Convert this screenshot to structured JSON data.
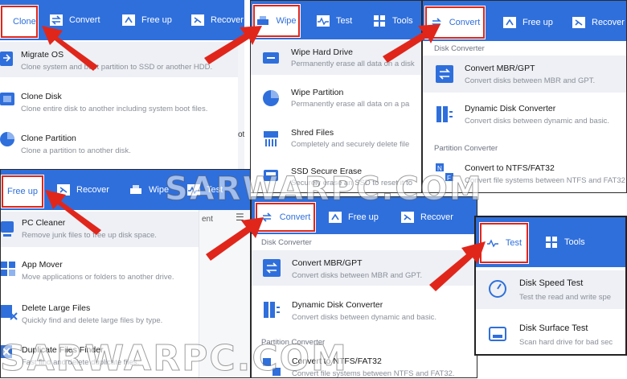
{
  "colors": {
    "brand": "#2f6fdc",
    "highlight": "#e0261b",
    "hover_bg": "#eef0f5",
    "icon_blue": "#2f6fdc"
  },
  "p1": {
    "tabs": [
      {
        "label": "Clone",
        "icon": "clone-icon",
        "active": true
      },
      {
        "label": "Convert",
        "icon": "convert-icon"
      },
      {
        "label": "Free up",
        "icon": "free-up-icon"
      },
      {
        "label": "Recover",
        "icon": "recover-icon"
      }
    ],
    "items": [
      {
        "title": "Migrate OS",
        "desc": "Clone system and boot partition to SSD or another HDD.",
        "icon": "migrate-os-icon"
      },
      {
        "title": "Clone Disk",
        "desc": "Clone entire disk to another including system boot files.",
        "icon": "clone-disk-icon"
      },
      {
        "title": "Clone Partition",
        "desc": "Clone a partition to another disk.",
        "icon": "clone-partition-icon"
      }
    ],
    "fragments": [
      "ot",
      "ent"
    ]
  },
  "p2": {
    "tabs": [
      {
        "label": "Wipe",
        "icon": "wipe-icon",
        "active": true
      },
      {
        "label": "Test",
        "icon": "test-icon"
      },
      {
        "label": "Tools",
        "icon": "tools-icon"
      }
    ],
    "items": [
      {
        "title": "Wipe Hard Drive",
        "desc": "Permanently erase all data on a disk",
        "icon": "wipe-drive-icon"
      },
      {
        "title": "Wipe Partition",
        "desc": "Permanently erase all data on a pa",
        "icon": "wipe-partition-icon"
      },
      {
        "title": "Shred Files",
        "desc": "Completely and securely delete file",
        "icon": "shred-files-icon"
      },
      {
        "title": "SSD Secure Erase",
        "desc": "Securely erase an SSD to reset it to",
        "icon": "ssd-erase-icon"
      }
    ]
  },
  "p3": {
    "tabs": [
      {
        "label": "Convert",
        "icon": "convert-icon",
        "active": true
      },
      {
        "label": "Free up",
        "icon": "free-up-icon"
      },
      {
        "label": "Recover",
        "icon": "recover-icon"
      }
    ],
    "section1": "Disk Converter",
    "items": [
      {
        "title": "Convert MBR/GPT",
        "desc": "Convert disks between MBR and GPT.",
        "icon": "convert-mbr-gpt-icon"
      },
      {
        "title": "Dynamic Disk Converter",
        "desc": "Convert disks between dynamic and basic.",
        "icon": "dynamic-disk-icon"
      }
    ],
    "section2": "Partition Converter",
    "items2": [
      {
        "title": "Convert to NTFS/FAT32",
        "desc": "Convert file systems between NTFS and FAT32",
        "icon": "convert-ntfs-icon"
      }
    ]
  },
  "p4": {
    "tabs": [
      {
        "label": "Free up",
        "icon": "free-up-icon",
        "active": true
      },
      {
        "label": "Recover",
        "icon": "recover-icon"
      },
      {
        "label": "Wipe",
        "icon": "wipe-icon"
      },
      {
        "label": "Test",
        "icon": "test-icon"
      }
    ],
    "items": [
      {
        "title": "PC Cleaner",
        "desc": "Remove junk files to free up disk space.",
        "icon": "pc-cleaner-icon"
      },
      {
        "title": "App Mover",
        "desc": "Move applications or folders to another drive.",
        "icon": "app-mover-icon"
      },
      {
        "title": "Delete Large Files",
        "desc": "Quickly find and delete large files by type.",
        "icon": "delete-large-icon"
      },
      {
        "title": "Duplicate Files Finder",
        "desc": "Fast find and delete duplicate files.",
        "icon": "duplicate-finder-icon"
      }
    ]
  },
  "p5": {
    "tabs": [
      {
        "label": "Convert",
        "icon": "convert-icon",
        "active": true
      },
      {
        "label": "Free up",
        "icon": "free-up-icon"
      },
      {
        "label": "Recover",
        "icon": "recover-icon"
      }
    ],
    "section1": "Disk Converter",
    "items": [
      {
        "title": "Convert MBR/GPT",
        "desc": "Convert disks between MBR and GPT.",
        "icon": "convert-mbr-gpt-icon"
      },
      {
        "title": "Dynamic Disk Converter",
        "desc": "Convert disks between dynamic and basic.",
        "icon": "dynamic-disk-icon"
      }
    ],
    "section2": "Partition Converter",
    "items2": [
      {
        "title": "Convert to NTFS/FAT32",
        "desc": "Convert file systems between NTFS and FAT32.",
        "icon": "convert-ntfs-icon"
      }
    ]
  },
  "p6": {
    "tabs": [
      {
        "label": "Test",
        "icon": "test-icon",
        "active": true
      },
      {
        "label": "Tools",
        "icon": "tools-icon"
      }
    ],
    "items": [
      {
        "title": "Disk Speed Test",
        "desc": "Test the read and write spe",
        "icon": "disk-speed-icon"
      },
      {
        "title": "Disk Surface Test",
        "desc": "Scan hard drive for bad sec",
        "icon": "disk-surface-icon"
      }
    ]
  },
  "watermark1": "SARWARPC.COM",
  "watermark2": "SARWARPC.COM"
}
